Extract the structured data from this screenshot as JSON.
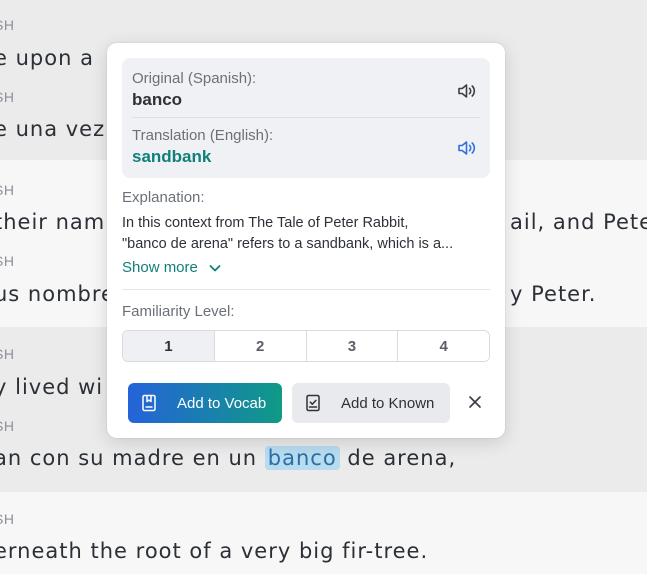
{
  "background": {
    "sections": [
      {
        "lang": "SH",
        "line": "e upon a"
      },
      {
        "lang": "SH",
        "line": "e una vez"
      },
      {
        "lang": "SH",
        "line_left": "their nam",
        "line_right": "ail, and Peter"
      },
      {
        "lang": "SH",
        "line_left": "us nombre",
        "line_right": "y Peter."
      },
      {
        "lang": "SH",
        "line": "y lived wi"
      },
      {
        "lang": "SH",
        "line_before": "an con su madre en un",
        "line_highlight": "banco",
        "line_after": "de arena,"
      },
      {
        "lang": "SH",
        "line": "erneath the root of a very big fir-tree."
      }
    ]
  },
  "popup": {
    "original_label": "Original (Spanish):",
    "original_word": "banco",
    "translation_label": "Translation (English):",
    "translation_word": "sandbank",
    "explanation_label": "Explanation:",
    "explanation_line1": "In this context from The Tale of Peter Rabbit,",
    "explanation_line2": "\"banco de arena\" refers to a sandbank, which is a...",
    "show_more": "Show more",
    "familiarity_label": "Familiarity Level:",
    "levels": [
      "1",
      "2",
      "3",
      "4"
    ],
    "selected_level": "1",
    "add_vocab": "Add to Vocab",
    "add_known": "Add to Known"
  },
  "colors": {
    "teal": "#11807a",
    "blue": "#2563d9",
    "highlight": "#b7dbef"
  }
}
